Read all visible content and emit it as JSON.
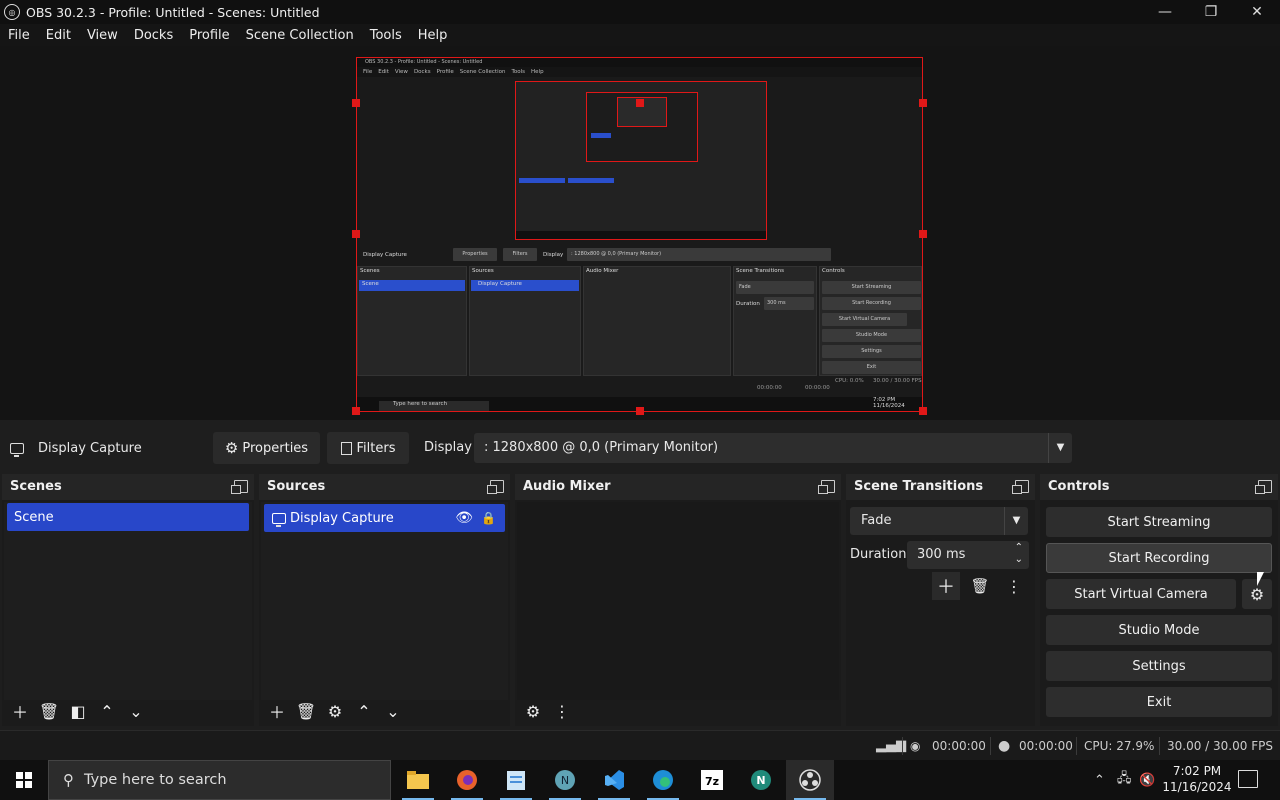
{
  "window": {
    "title": "OBS 30.2.3 - Profile: Untitled - Scenes: Untitled",
    "minimize": "—",
    "restore": "❐",
    "close": "✕"
  },
  "menu": [
    "File",
    "Edit",
    "View",
    "Docks",
    "Profile",
    "Scene Collection",
    "Tools",
    "Help"
  ],
  "preview": {
    "mini": {
      "title": "OBS 30.2.3 - Profile: Untitled - Scenes: Untitled",
      "menu": [
        "File",
        "Edit",
        "View",
        "Docks",
        "Profile",
        "Scene Collection",
        "Tools",
        "Help"
      ],
      "source_name": "Display Capture",
      "properties": "Properties",
      "filters": "Filters",
      "display_label": "Display",
      "display_value": ": 1280x800 @ 0,0 (Primary Monitor)",
      "docks": [
        "Scenes",
        "Sources",
        "Audio Mixer",
        "Scene Transitions",
        "Controls"
      ],
      "scene": "Scene",
      "source": "Display Capture",
      "transition": "Fade",
      "duration_label": "Duration",
      "duration": "300 ms",
      "controls": [
        "Start Streaming",
        "Start Recording",
        "Start Virtual Camera",
        "Studio Mode",
        "Settings",
        "Exit"
      ],
      "status": [
        "00:00:00",
        "00:00:00",
        "CPU: 0.0%",
        "30.00 / 30.00 FPS"
      ],
      "search": "Type here to search",
      "time": "7:02 PM",
      "date": "11/16/2024"
    }
  },
  "source_toolbar": {
    "source_name": "Display Capture",
    "properties": "Properties",
    "filters": "Filters",
    "display_label": "Display",
    "display_value": ": 1280x800 @ 0,0 (Primary Monitor)"
  },
  "docks": {
    "scenes": {
      "title": "Scenes",
      "items": [
        "Scene"
      ]
    },
    "sources": {
      "title": "Sources",
      "items": [
        "Display Capture"
      ]
    },
    "audio_mixer": {
      "title": "Audio Mixer"
    },
    "transitions": {
      "title": "Scene Transitions",
      "transition": "Fade",
      "duration_label": "Duration",
      "duration": "300 ms"
    },
    "controls": {
      "title": "Controls",
      "start_streaming": "Start Streaming",
      "start_recording": "Start Recording",
      "start_virtual_camera": "Start Virtual Camera",
      "studio_mode": "Studio Mode",
      "settings": "Settings",
      "exit": "Exit"
    }
  },
  "status": {
    "stream_time": "00:00:00",
    "record_time": "00:00:00",
    "cpu": "CPU: 27.9%",
    "fps": "30.00 / 30.00 FPS"
  },
  "taskbar": {
    "search_placeholder": "Type here to search",
    "time": "7:02 PM",
    "date": "11/16/2024",
    "apps": [
      "file-explorer-icon",
      "firefox-icon",
      "notepad-icon",
      "notion-icon",
      "vscode-icon",
      "edge-icon",
      "7zip-icon",
      "app-n-icon",
      "obs-icon"
    ],
    "zip_label": "7z",
    "n_label": "N"
  },
  "colors": {
    "accent_blue": "#2847c9",
    "selection_red": "#e01818",
    "panel_bg": "#1e1e1e"
  }
}
